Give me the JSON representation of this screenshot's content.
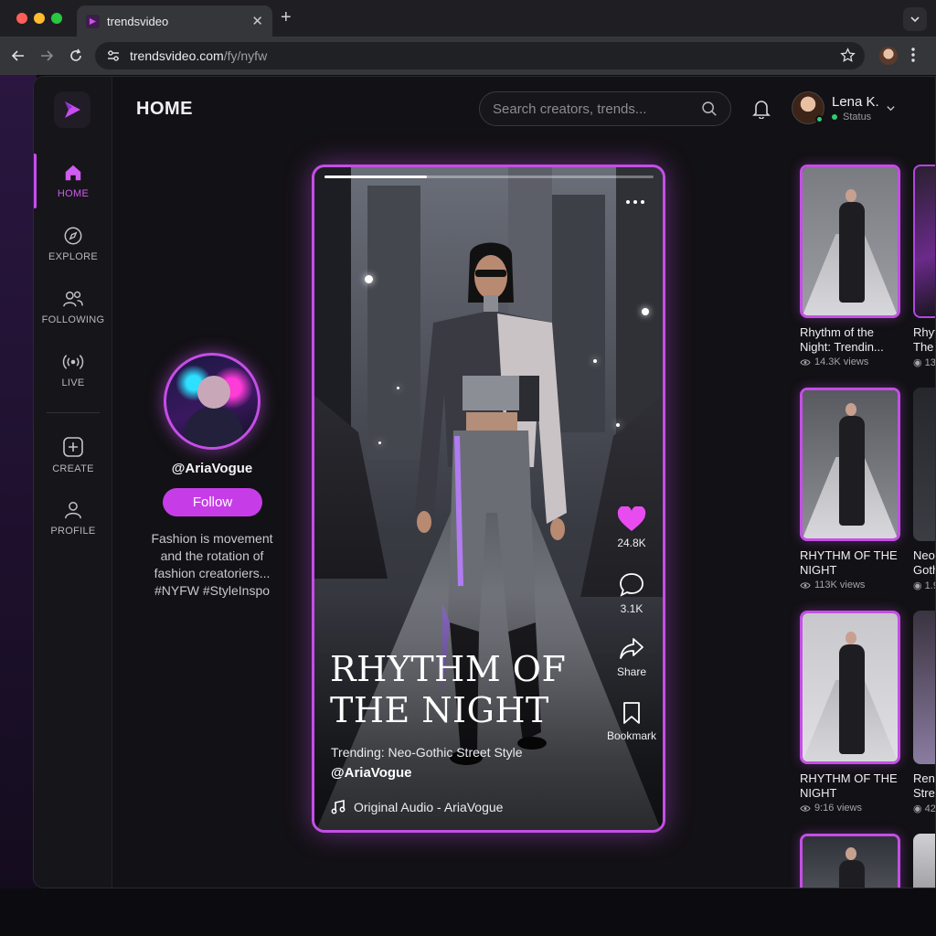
{
  "browser": {
    "tab_title": "trendsvideo",
    "url_host": "trendsvideo.com",
    "url_path": "/fy/nyfw"
  },
  "header": {
    "title": "HOME",
    "search_placeholder": "Search creators, trends...",
    "user_name": "Lena K.",
    "user_status": "Status"
  },
  "sidebar": {
    "items": [
      {
        "label": "HOME",
        "icon": "home-icon",
        "active": true
      },
      {
        "label": "EXPLORE",
        "icon": "compass-icon"
      },
      {
        "label": "FOLLOWING",
        "icon": "users-icon"
      },
      {
        "label": "LIVE",
        "icon": "live-broadcast-icon"
      },
      {
        "label": "CREATE",
        "icon": "plus-square-icon"
      },
      {
        "label": "PROFILE",
        "icon": "user-icon"
      }
    ]
  },
  "creator": {
    "handle": "@AriaVogue",
    "follow_label": "Follow",
    "bio": "Fashion is movement and the rotation of fashion creatoriers... #NYFW #StyleInspo"
  },
  "video": {
    "progress": 0.31,
    "title": "RHYTHM OF THE NIGHT",
    "subtitle": "Trending: Neo-Gothic Street Style",
    "handle": "@AriaVogue",
    "audio": "Original Audio - AriaVogue",
    "likes": "24.8K",
    "comments": "3.1K",
    "share_label": "Share",
    "bookmark_label": "Bookmark"
  },
  "grid": [
    {
      "title": "Rhythm of the Night: Trendin...",
      "views": "14.3K views"
    },
    {
      "title": "RHYTHM OF THE NIGHT",
      "views": "113K views"
    },
    {
      "title": "RHYTHM OF THE NIGHT",
      "views": "9:16 views"
    }
  ],
  "grid_partial": [
    {
      "title": "Rhyt",
      "title2": "The",
      "views": "13"
    },
    {
      "title": "Neo",
      "title2": "Goth",
      "views": "1.9"
    },
    {
      "title": "Reni",
      "title2": "Stre",
      "views": "42"
    }
  ],
  "colors": {
    "accent": "#c63de8",
    "accent_glow": "#c54ee6",
    "heart": "#e84cf0",
    "online": "#2ecc71"
  }
}
